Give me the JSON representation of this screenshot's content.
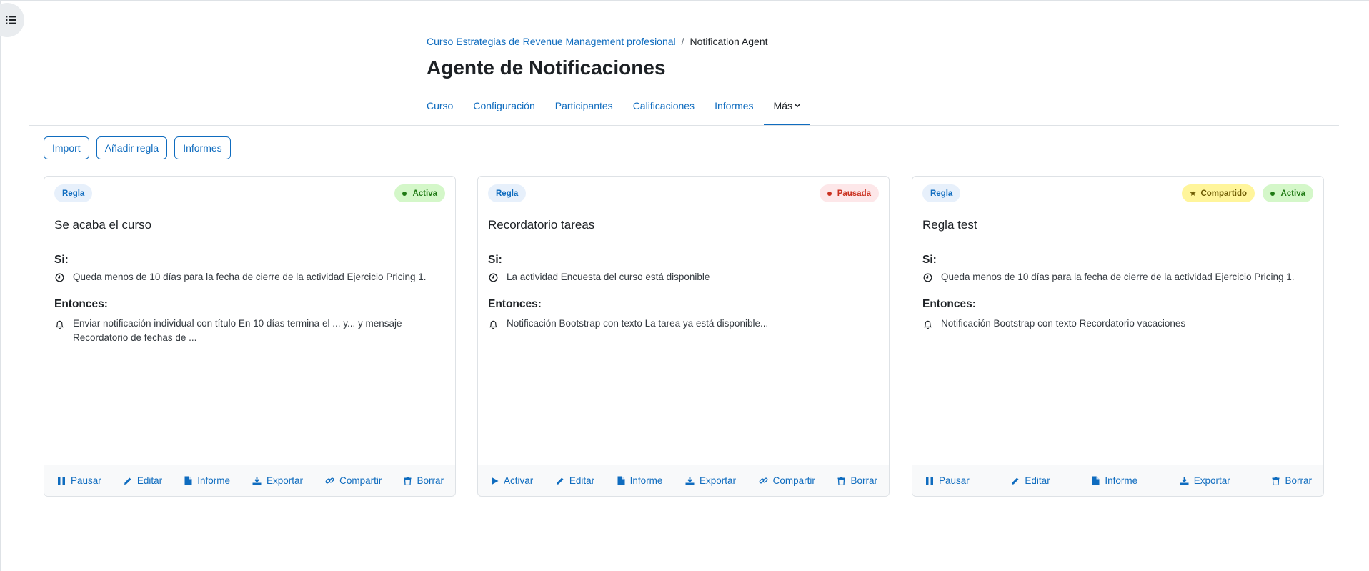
{
  "breadcrumb": {
    "course": "Curso Estrategias de Revenue Management profesional",
    "separator": "/",
    "current": "Notification Agent"
  },
  "page_title": "Agente de Notificaciones",
  "nav": {
    "tabs": [
      "Curso",
      "Configuración",
      "Participantes",
      "Calificaciones",
      "Informes"
    ],
    "more": "Más"
  },
  "actions": {
    "import": "Import",
    "add_rule": "Añadir regla",
    "reports": "Informes"
  },
  "cards": [
    {
      "badge": "Regla",
      "status": "Activa",
      "title": "Se acaba el curso",
      "if_label": "Si:",
      "condition": "Queda menos de 10 días para la fecha de cierre de la actividad Ejercicio Pricing 1.",
      "then_label": "Entonces:",
      "action_line1": "Enviar notificación individual con título En 10 días termina el ... y... y mensaje",
      "action_line2": "Recordatorio de fechas de ...",
      "footer": [
        "Pausar",
        "Editar",
        "Informe",
        "Exportar",
        "Compartir",
        "Borrar"
      ]
    },
    {
      "badge": "Regla",
      "status": "Pausada",
      "title": "Recordatorio tareas",
      "if_label": "Si:",
      "condition": "La actividad Encuesta del curso está disponible",
      "then_label": "Entonces:",
      "action_line1": "Notificación Bootstrap con texto La tarea ya está disponible...",
      "footer": [
        "Activar",
        "Editar",
        "Informe",
        "Exportar",
        "Compartir",
        "Borrar"
      ]
    },
    {
      "badge": "Regla",
      "shared": "Compartido",
      "status": "Activa",
      "title": "Regla test",
      "if_label": "Si:",
      "condition": "Queda menos de 10 días para la fecha de cierre de la actividad Ejercicio Pricing 1.",
      "then_label": "Entonces:",
      "action_line1": "Notificación Bootstrap con texto Recordatorio vacaciones",
      "footer": [
        "Pausar",
        "Editar",
        "Informe",
        "Exportar",
        "Borrar"
      ]
    }
  ],
  "colors": {
    "link": "#0f6cbf",
    "active": "#1f7a14",
    "paused": "#ca3120",
    "shared": "#fff59b"
  }
}
